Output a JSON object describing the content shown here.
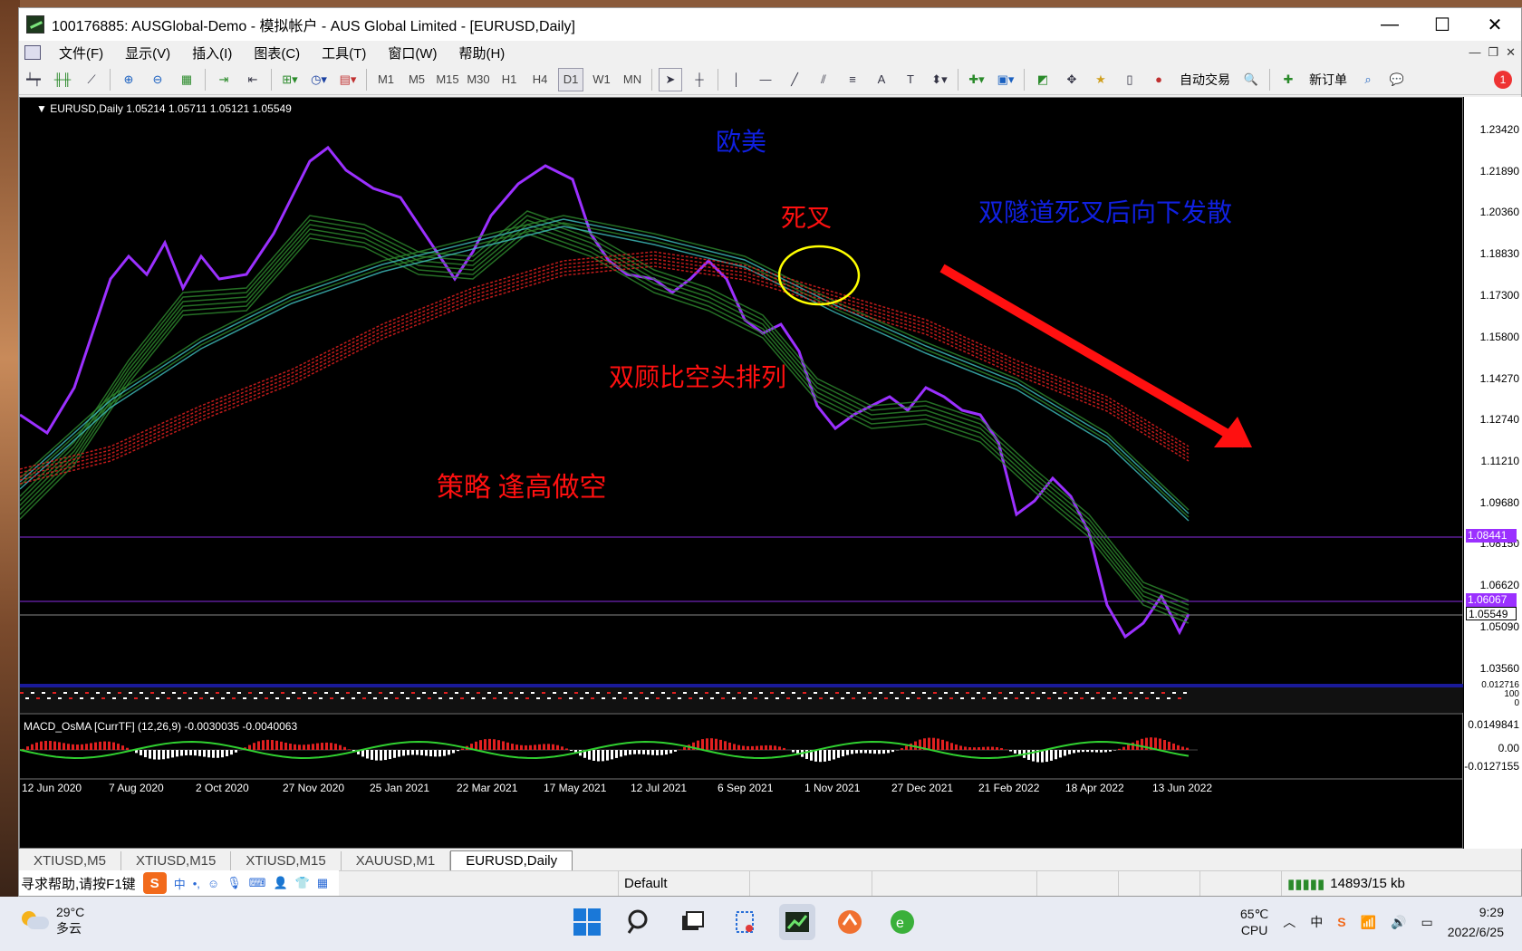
{
  "window": {
    "title": "100176885: AUSGlobal-Demo - 模拟帐户 - AUS Global Limited - [EURUSD,Daily]",
    "minimize": "—",
    "maximize": "☐",
    "close": "✕"
  },
  "menu": [
    "文件(F)",
    "显示(V)",
    "插入(I)",
    "图表(C)",
    "工具(T)",
    "窗口(W)",
    "帮助(H)"
  ],
  "toolbar": {
    "timeframes": [
      "M1",
      "M5",
      "M15",
      "M30",
      "H1",
      "H4",
      "D1",
      "W1",
      "MN"
    ],
    "active_timeframe": "D1",
    "auto_trade": "自动交易",
    "new_order": "新订单",
    "notification_count": "1",
    "text_tool": "A"
  },
  "chart": {
    "header": "EURUSD,Daily  1.05214 1.05711 1.05121 1.05549",
    "annotations": {
      "pair": "欧美",
      "death_cross": "死叉",
      "tunnel_desc": "双隧道死叉后向下发散",
      "alignment": "双顾比空头排列",
      "strategy": "策略   逢高做空"
    },
    "price_labels": [
      "1.23420",
      "1.21890",
      "1.20360",
      "1.18830",
      "1.17300",
      "1.15800",
      "1.14270",
      "1.12740",
      "1.11210",
      "1.09680",
      "1.08150",
      "1.06620",
      "1.05090",
      "1.03560"
    ],
    "marker_labels": {
      "upper": "1.08441",
      "middle": "1.06067",
      "current": "1.05549"
    },
    "date_labels": [
      "12 Jun 2020",
      "7 Aug 2020",
      "2 Oct 2020",
      "27 Nov 2020",
      "25 Jan 2021",
      "22 Mar 2021",
      "17 May 2021",
      "12 Jul 2021",
      "6 Sep 2021",
      "1 Nov 2021",
      "27 Dec 2021",
      "21 Feb 2022",
      "18 Apr 2022",
      "13 Jun 2022"
    ],
    "macd_header": "MACD_OsMA [CurrTF] (12,26,9) -0.0030035 -0.0040063",
    "macd_labels": [
      "0.0149841",
      "0.00",
      "-0.0127155"
    ],
    "sub_labels": [
      "0.012716",
      "100",
      "0"
    ]
  },
  "tabs": [
    {
      "label": "XTIUSD,M5",
      "active": false
    },
    {
      "label": "XTIUSD,M15",
      "active": false
    },
    {
      "label": "XTIUSD,M15",
      "active": false
    },
    {
      "label": "XAUUSD,M1",
      "active": false
    },
    {
      "label": "EURUSD,Daily",
      "active": true
    }
  ],
  "status": {
    "help": "寻求帮助,请按F1键",
    "profile": "Default",
    "traffic": "14893/15 kb"
  },
  "ime": {
    "logo": "S",
    "items": [
      "中",
      "•,",
      "☺",
      "🎙",
      "⌨",
      "👤",
      "👕",
      "▦"
    ]
  },
  "taskbar": {
    "temperature": "29°C",
    "weather": "多云",
    "cpu_temp": "65℃",
    "cpu_label": "CPU",
    "time": "9:29",
    "date": "2022/6/25"
  },
  "colors": {
    "price_line": "#9b30ff",
    "short_ema": "#2e8b2e",
    "long_ema_teal": "#40c0c0",
    "long_ema_red": "#e02020",
    "annotation_blue": "#1020e0",
    "annotation_red": "#ff1010",
    "circle": "#ffff00"
  }
}
